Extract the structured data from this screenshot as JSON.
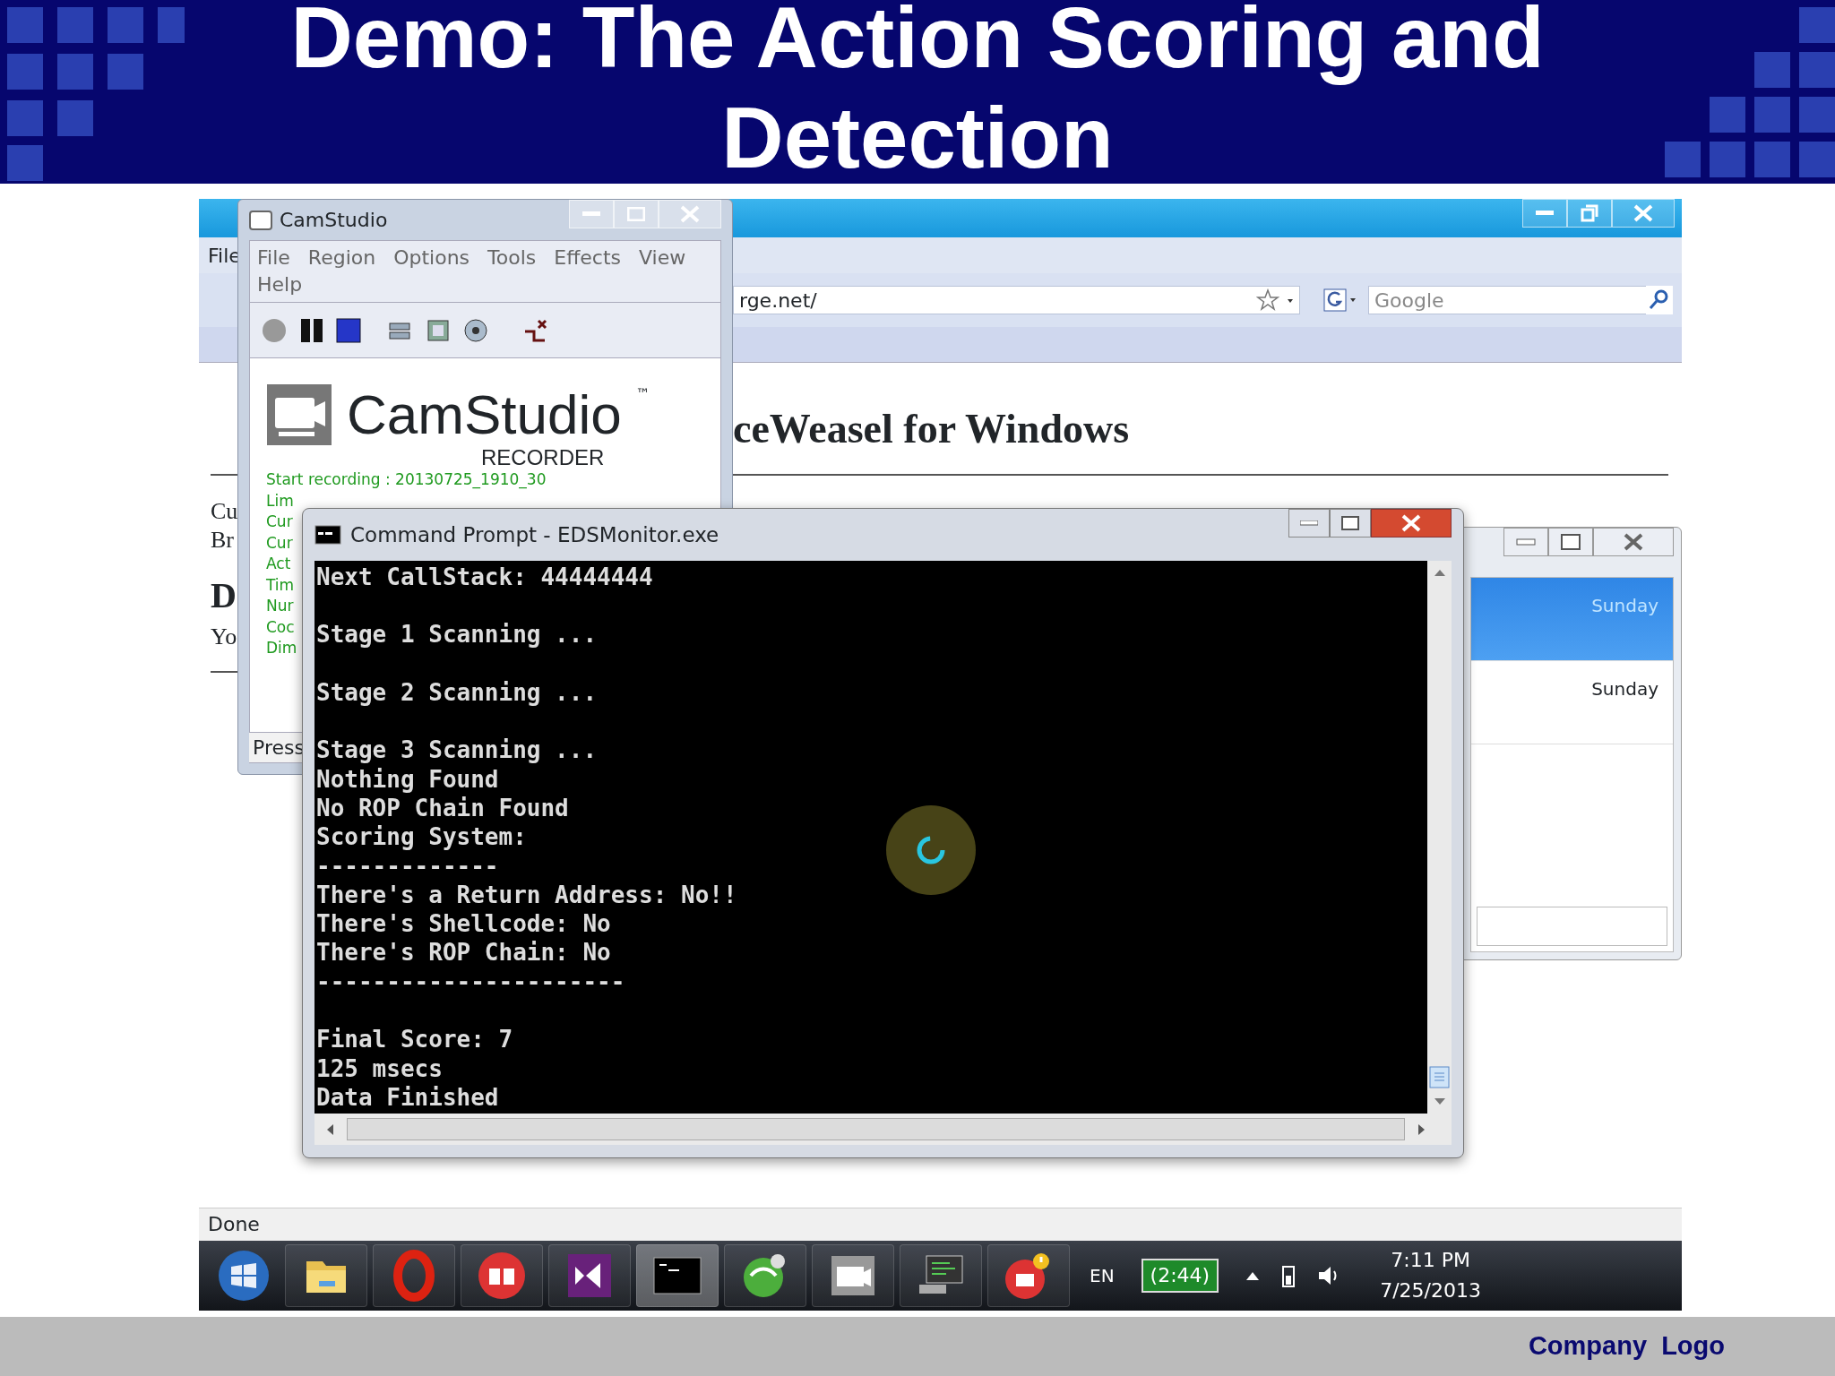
{
  "slide": {
    "title_lines": [
      "Demo: The Action Scoring and",
      "Detection"
    ],
    "footer": "Company  Logo"
  },
  "browser": {
    "menu": [
      "File"
    ],
    "url": "rge.net/",
    "search": {
      "placeholder": "Google"
    },
    "heading": "ceWeasel for Windows",
    "fragments": [
      {
        "text": "Cu",
        "kind": "line"
      },
      {
        "text": "Br",
        "kind": "line"
      },
      {
        "text": "D",
        "kind": "heading"
      },
      {
        "text": "Yo",
        "kind": "line"
      }
    ],
    "status": "Done"
  },
  "camstudio": {
    "title": "CamStudio",
    "menu": [
      "File",
      "Region",
      "Options",
      "Tools",
      "Effects",
      "View",
      "Help"
    ],
    "logo": "CamStudio",
    "logo_mark": "™",
    "logo_sub": "RECORDER",
    "status_lines": [
      "Start recording : 20130725_1910_30",
      "Lim",
      "Cur",
      "Cur",
      "Act",
      "Tim",
      "Nur",
      "Coc",
      "Dim"
    ],
    "status_bar": "Press"
  },
  "console": {
    "title": "Command Prompt - EDSMonitor.exe",
    "paragraphs": [
      [
        "Next CallStack: 44444444"
      ],
      [
        "Stage 1 Scanning ..."
      ],
      [
        "Stage 2 Scanning ..."
      ],
      [
        "Stage 3 Scanning ...",
        "Nothing Found",
        "No ROP Chain Found",
        "Scoring System:",
        "-------------",
        "There's a Return Address: No!!",
        "There's Shellcode: No",
        "There's ROP Chain: No",
        "----------------------"
      ],
      [
        "Final Score: 7",
        "125 msecs",
        "Data Finished"
      ]
    ]
  },
  "calendar_window": {
    "rows": [
      {
        "label": "Sunday",
        "selected": true
      },
      {
        "label": "Sunday",
        "selected": false
      }
    ]
  },
  "taskbar": {
    "language": "EN",
    "battery": "(2:44)",
    "time": "7:11 PM",
    "date": "7/25/2013"
  }
}
